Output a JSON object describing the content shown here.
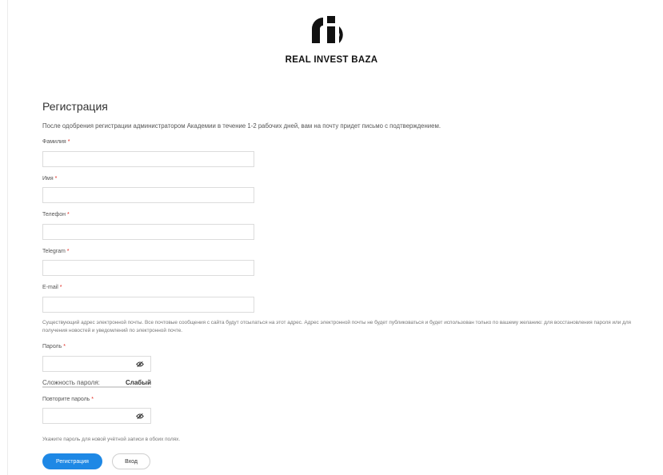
{
  "header": {
    "logo_icon": "riv-logo-icon",
    "brand_name": "REAL INVEST BAZA"
  },
  "form": {
    "title": "Регистрация",
    "intro": "После одобрения регистрации администратором Академии в течение 1-2 рабочих дней, вам на почту придет письмо с подтверждением.",
    "required_mark": "*",
    "last_name": {
      "label": "Фамилия",
      "value": ""
    },
    "first_name": {
      "label": "Имя",
      "value": ""
    },
    "phone": {
      "label": "Телефон",
      "value": ""
    },
    "telegram": {
      "label": "Telegram",
      "value": ""
    },
    "email": {
      "label": "E-mail",
      "value": "",
      "description": "Существующий адрес электронной почты. Все почтовые сообщения с сайта будут отсылаться на этот адрес. Адрес электронной почты не будет публиковаться и будет использован только по вашему желанию: для восстановления пароля или для получения новостей и уведомлений по электронной почте."
    },
    "password": {
      "label": "Пароль",
      "value": "",
      "toggle_icon": "eye-icon"
    },
    "password_strength": {
      "label": "Сложность пароля:",
      "value": "Слабый"
    },
    "confirm_password": {
      "label": "Повторите пароль",
      "value": "",
      "toggle_icon": "eye-icon"
    },
    "password_hint": "Укажите пароль для новой учётной записи в обоих полях.",
    "submit_label": "Регистрация",
    "login_label": "Вход"
  },
  "colors": {
    "accent": "#1e88e5",
    "required": "#e2231a"
  }
}
